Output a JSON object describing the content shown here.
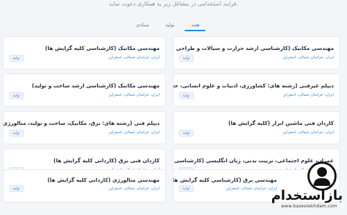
{
  "intro": "فرایند استخدامی در مشاغل زیر به همکاری دعوت نماید.",
  "tabs": [
    {
      "label": "همه"
    },
    {
      "label": "تولید"
    },
    {
      "label": "ستادی"
    }
  ],
  "jobs": [
    {
      "title": "مهندسی مکانیک (کارشناسی ارشد حرارت و سیالات و طراحی جامدات)",
      "location": "ایران، خراسان شمالی، اسفراین",
      "tag": "تولید"
    },
    {
      "title": "مهندسی مکانیک (کارشناسی کلیه گرایش ها)",
      "location": "ایران، خراسان شمالی، اسفراین",
      "tag": "تولید"
    },
    {
      "title": "دیپلم غیرفنی (رشته های: کشاورزی، ادبیات و علوم انسانی، حسابداری، کام...",
      "location": "ایران، خراسان شمالی، اسفراین",
      "tag": "تولید"
    },
    {
      "title": "مهندسی مکانیک (کارشناسی ارشد ساخت و تولید)",
      "location": "ایران، خراسان شمالی، اسفراین",
      "tag": "تولید"
    },
    {
      "title": "کاردان فنی ماشین ابزار (کلیه گرایش ها)",
      "location": "ایران، خراسان شمالی، اسفراین",
      "tag": "تولید"
    },
    {
      "title": "دیپلم فنی (رشته های: برق، مکانیک، ساخت و تولید، متالورژی)",
      "location": "ایران، خراسان شمالی، اسفراین",
      "tag": "تولید"
    },
    {
      "title": "عمران، علوم اجتماعی، تربیت بدنی، زبان انگلیسی (کارشناسی کلیه گرایش ...",
      "location": "ایران، خراسان شمالی، اسفراین",
      "tag": "تولید"
    },
    {
      "title": "کاردان فنی برق (کاردانی کلیه گرایش ها)",
      "location": "ایران، خراسان شمالی، اسفراین",
      "tag": "تولید"
    },
    {
      "title": "مهندسی برق (کارشناسی کلیه گرایش ها)",
      "location": "ایران، خراسان شمالی، اسفراین",
      "tag": "تولید"
    },
    {
      "title": "مهندسی متالورژی (کاردانی کلیه گرایش ها)",
      "location": "ایران، خراسان شمالی، اسفراین",
      "tag": "تولید"
    }
  ],
  "watermark": {
    "text": "بازاستخدام",
    "url": "www.bazestekhdam.com"
  }
}
